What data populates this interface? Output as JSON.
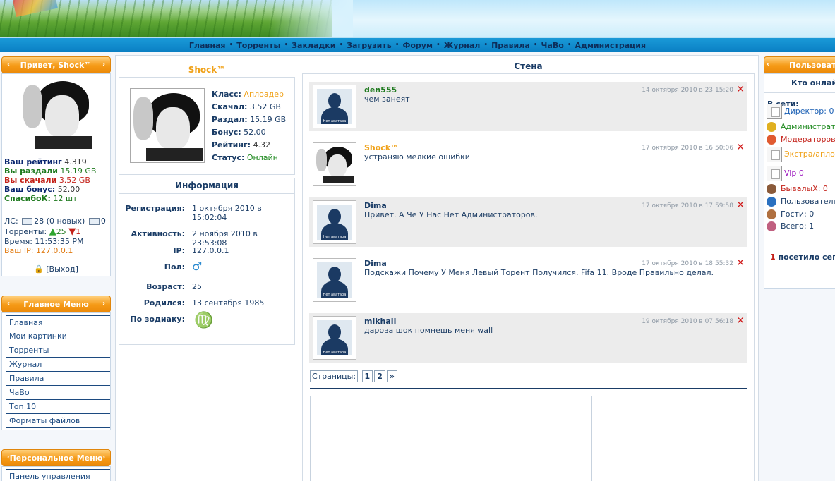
{
  "nav": [
    "Главная",
    "Торренты",
    "Закладки",
    "Загрузить",
    "Форум",
    "Журнал",
    "Правила",
    "ЧаВо",
    "Администрация"
  ],
  "left_user": {
    "greeting": "Привет, Shock™",
    "rating_label": "Ваш рейтинг",
    "rating": "4.319",
    "up_label": "Вы раздали",
    "up": "15.19 GB",
    "down_label": "Вы скачали",
    "down": "3.52 GB",
    "bonus_label": "Ваш бонус:",
    "bonus": "52.00",
    "thanks_label": "СпасибоК:",
    "thanks": "12 шт",
    "pm_label": "ЛС:",
    "pm_in": "28 (0 новых)",
    "pm_out": "0",
    "torrents_label": "Торренты:",
    "seeding": "25",
    "leeching": "1",
    "time_label": "Время:",
    "time": "11:53:35 PM",
    "ip_label": "Ваш IP:",
    "ip": "127.0.0.1",
    "logout": "[Выход]"
  },
  "main_menu": {
    "title": "Главное Меню",
    "items": [
      "Главная",
      "Мои картинки",
      "Торренты",
      "Журнал",
      "Правила",
      "ЧаВо",
      "Топ 10",
      "Форматы файлов"
    ]
  },
  "personal_menu": {
    "title": "Персональное Меню",
    "items": [
      "Панель управления"
    ]
  },
  "profile": {
    "username": "Shock™",
    "class_label": "Класс:",
    "class": "Аплоадер",
    "down_label": "Скачал:",
    "down": "3.52 GB",
    "up_label": "Раздал:",
    "up": "15.19 GB",
    "bonus_label": "Бонус:",
    "bonus": "52.00",
    "rating_label": "Рейтинг:",
    "rating": "4.32",
    "status_label": "Статус:",
    "status": "Онлайн"
  },
  "info": {
    "title": "Информация",
    "reg_label": "Регистрация:",
    "reg": "1 октября 2010 в 15:02:04",
    "act_label": "Активность:",
    "act": "2 ноября 2010 в 23:53:08",
    "ip_label": "IP:",
    "ip": "127.0.0.1",
    "sex_label": "Пол:",
    "sex_icon": "male-icon",
    "sex_glyph": "♂",
    "age_label": "Возраст:",
    "age": "25",
    "born_label": "Родился:",
    "born": "13 сентября 1985",
    "zodiac_label": "По зодиаку:",
    "zodiac_icon": "virgo-icon",
    "zodiac_glyph": "♍"
  },
  "wall": {
    "title": "Стена",
    "posts": [
      {
        "name": "den555",
        "msg": "чем занеят",
        "date": "14 октября 2010 в 23:15:20",
        "avatar": "none",
        "name_color": "#1f7a1f"
      },
      {
        "name": "Shock™",
        "msg": "устраняю мелкие  ошибки",
        "date": "17 октября 2010 в 16:50:06",
        "avatar": "user",
        "name_color": "#f0a21a"
      },
      {
        "name": "Dima",
        "msg": "Привет. А Че У Нас Нет Администраторов.",
        "date": "17 октября 2010 в 17:59:58",
        "avatar": "none",
        "name_color": "#1a3c66"
      },
      {
        "name": "Dima",
        "msg": "Подскажи Почему У Меня Левый Торент Получился. Fifa 11. Вроде Правильно делал.",
        "date": "17 октября 2010 в 18:55:32",
        "avatar": "none",
        "name_color": "#1a3c66"
      },
      {
        "name": "mikhail",
        "msg": "дарова шок помнешь меня wall",
        "date": "19 октября 2010 в 07:56:18",
        "avatar": "none",
        "name_color": "#1a3c66"
      }
    ],
    "no_avatar_text": "Нет аватара",
    "pager_label": "Страницы:",
    "pages": [
      "1",
      "2",
      "»"
    ]
  },
  "right": {
    "title": "Пользовате",
    "who_online": "Кто онлай",
    "in_net": "В сети:",
    "rows": [
      {
        "label": "Директор: 0",
        "color": "#1a5fb4",
        "icon": "director-icon"
      },
      {
        "label": "Администрато",
        "color": "#1f8a1f",
        "icon": "admin-medal-icon"
      },
      {
        "label": "Модераторов",
        "color": "#c4221a",
        "icon": "moderator-star-icon"
      },
      {
        "label": "Экстра/аплод",
        "color": "#f0a21a",
        "icon": "extra-uploader-icon"
      },
      {
        "label": "Vip",
        "count": " 0",
        "color": "#a020c0",
        "icon": "vip-icon"
      },
      {
        "label": "БывалыХ:",
        "count": " 0",
        "color": "#c4221a",
        "icon": "veteran-icon"
      },
      {
        "label": "Пользователе",
        "color": "#1a3c66",
        "icon": "user-icon"
      },
      {
        "label": "Гости: 0",
        "color": "#1a3c66",
        "icon": "guest-icon"
      },
      {
        "label": "Всего: 1",
        "color": "#1a3c66",
        "icon": "group-icon"
      }
    ],
    "visited_count": "1",
    "visited_text": " посетило сего"
  }
}
